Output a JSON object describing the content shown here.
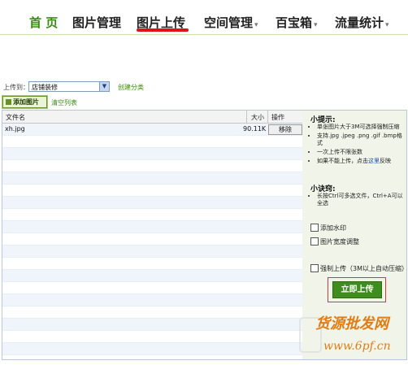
{
  "nav": {
    "home": "首 页",
    "pictures": "图片管理",
    "upload": "图片上传",
    "space": "空间管理",
    "toolbox": "百宝箱",
    "stats": "流量统计",
    "dropdown_glyph": "▾"
  },
  "destination": {
    "label": "上传到：",
    "selected": "店铺装修",
    "create_category": "创建分类"
  },
  "toolbar": {
    "add_label": "添加图片",
    "clear_label": "清空列表"
  },
  "table": {
    "columns": [
      "文件名",
      "大小",
      "操作"
    ],
    "rows": [
      {
        "name": "xh.jpg",
        "size": "90.11K",
        "action": "移除"
      }
    ]
  },
  "sidebar": {
    "tips_title": "小提示:",
    "tips": [
      "单张图片大于3M可选择强制压缩",
      "支持.jpg .jpeg .png .gif .bmp格式",
      "一次上传不限张数"
    ],
    "tip_last_prefix": "如果不能上传，点击",
    "tip_last_link": "这里",
    "tip_last_suffix": "反映",
    "tricks_title": "小诀窍:",
    "tricks": [
      "长按Ctrl可多选文件，Ctrl+A可以全选"
    ],
    "watermark_label": "添加水印",
    "width_label": "图片宽度调整",
    "compress_label": "强制上传（3M以上自动压缩）",
    "upload_button": "立即上传"
  },
  "watermark_logo": {
    "text": "货源批发网",
    "url": "www.6pf.cn"
  },
  "colors": {
    "accent_green": "#3f8d1e",
    "active_underline": "#e0111b",
    "watermark": "#e07d16"
  }
}
